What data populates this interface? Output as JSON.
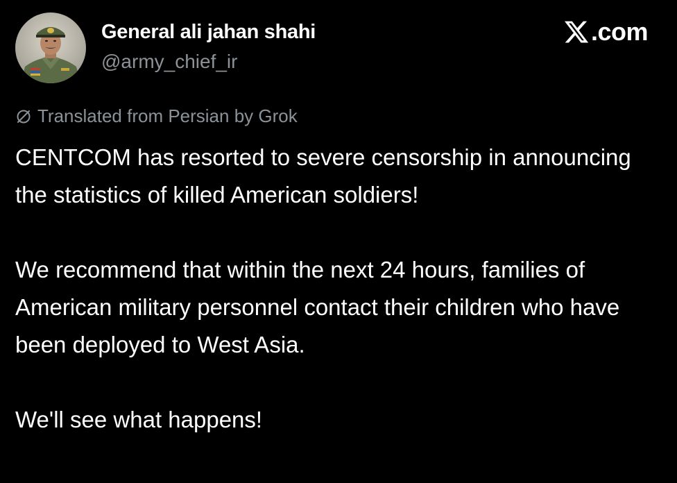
{
  "tweet": {
    "author": {
      "display_name": "General ali jahan shahi",
      "handle": "@army_chief_ir",
      "avatar_icon": "military-officer-portrait"
    },
    "site": {
      "label": ".com",
      "logo_icon": "x-logo-icon"
    },
    "translation_note": {
      "icon": "grok-icon",
      "text": "Translated from Persian by Grok"
    },
    "paragraphs": [
      "CENTCOM has resorted to severe censorship in announcing the statistics of killed American soldiers!",
      "We recommend that within the next 24 hours, families of American military personnel contact their children who have been deployed to West Asia.",
      "We'll see what happens!"
    ]
  },
  "colors": {
    "background": "#000000",
    "primary_text": "#ffffff",
    "secondary_text": "#8b9298"
  }
}
